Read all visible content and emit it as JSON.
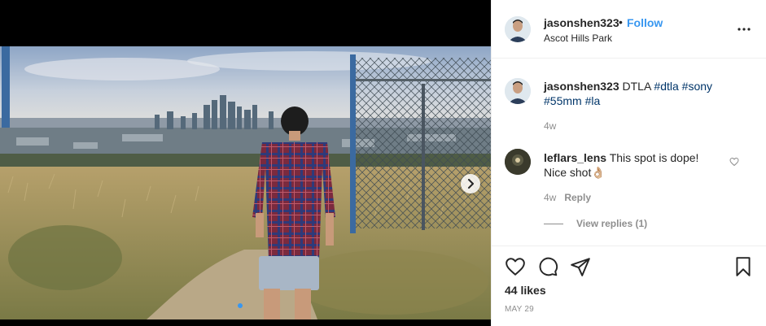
{
  "post": {
    "username": "jasonshen323",
    "separator": "•",
    "follow_label": "Follow",
    "location": "Ascot Hills Park",
    "more_icon": "more-horizontal-icon",
    "carousel": {
      "current_slide": 1,
      "total_slides": 2
    }
  },
  "caption": {
    "username": "jasonshen323",
    "text": "DTLA",
    "hashtags": [
      "#dtla",
      "#sony",
      "#55mm",
      "#la"
    ],
    "age": "4w"
  },
  "comments": [
    {
      "username": "leflars_lens",
      "text": "This spot is dope! Nice shot👌🏼",
      "age": "4w",
      "reply_label": "Reply",
      "view_replies_label": "View replies (1)"
    }
  ],
  "actions": {
    "like_icon": "heart-icon",
    "comment_icon": "comment-bubble-icon",
    "share_icon": "paper-plane-icon",
    "save_icon": "bookmark-icon"
  },
  "likes_text": "44 likes",
  "date": "MAY 29",
  "colors": {
    "link": "#3897f0",
    "hashtag": "#003569",
    "muted": "#8e8e8e",
    "text": "#262626"
  }
}
